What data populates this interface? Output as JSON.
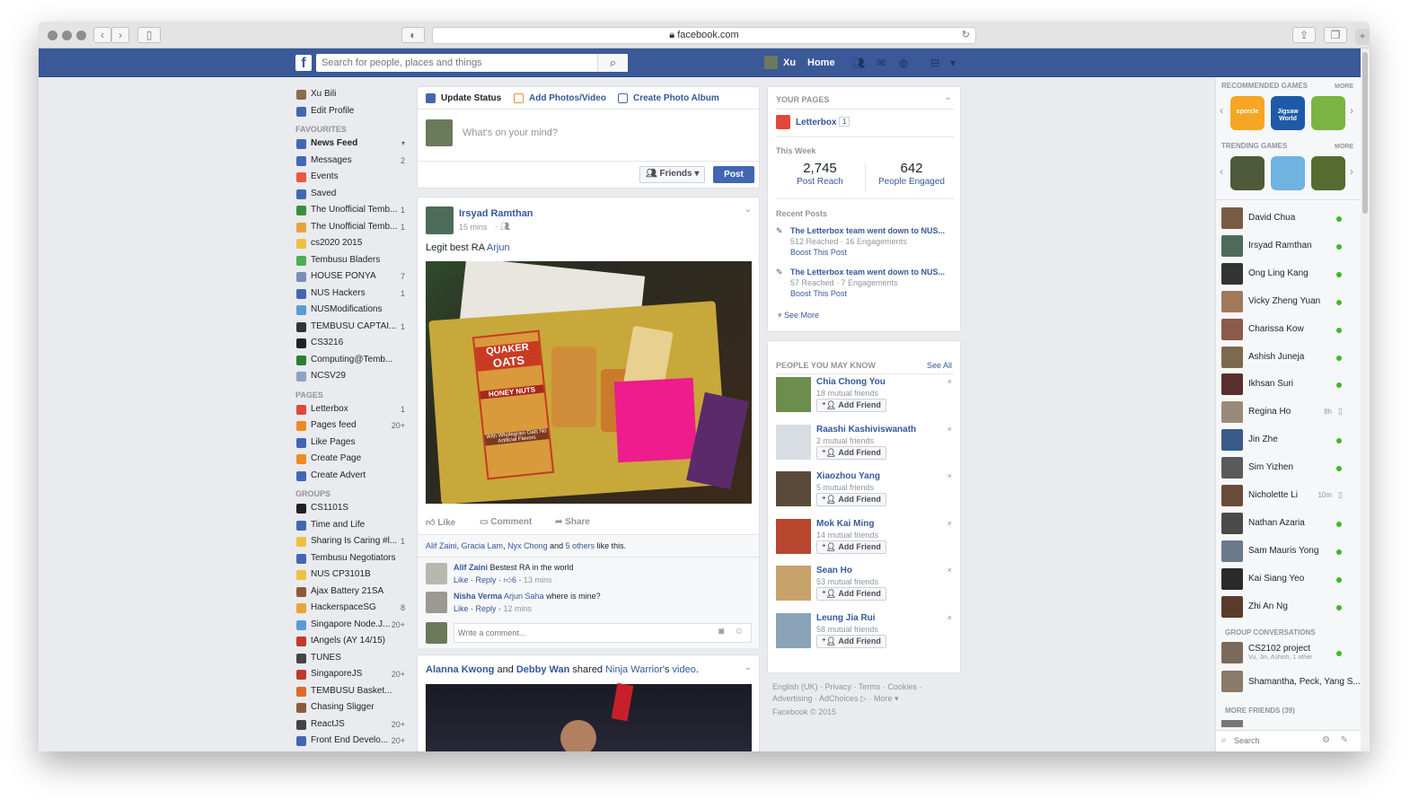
{
  "browser": {
    "url": "facebook.com"
  },
  "header": {
    "search_placeholder": "Search for people, places and things",
    "user_name": "Xu",
    "home": "Home"
  },
  "leftnav": {
    "profile": [
      {
        "label": "Xu Bili",
        "color": "#8a6d4a"
      },
      {
        "label": "Edit Profile",
        "color": "#4267b2"
      }
    ],
    "favourites_title": "FAVOURITES",
    "favourites": [
      {
        "label": "News Feed",
        "count": "",
        "color": "#4267b2",
        "bold": true
      },
      {
        "label": "Messages",
        "count": "2",
        "color": "#4267b2"
      },
      {
        "label": "Events",
        "count": "",
        "color": "#e9573f"
      },
      {
        "label": "Saved",
        "count": "",
        "color": "#4267b2"
      },
      {
        "label": "The Unofficial Temb...",
        "count": "1",
        "color": "#3a8f3a"
      },
      {
        "label": "The Unofficial Temb...",
        "count": "1",
        "color": "#e8a33a"
      },
      {
        "label": "cs2020 2015",
        "count": "",
        "color": "#f0c040"
      },
      {
        "label": "Tembusu Bladers",
        "count": "",
        "color": "#4caf50"
      },
      {
        "label": "HOUSE PONYA",
        "count": "7",
        "color": "#7a8fb5"
      },
      {
        "label": "NUS Hackers",
        "count": "1",
        "color": "#4267b2"
      },
      {
        "label": "NUSModifications",
        "count": "",
        "color": "#5b9bd5"
      },
      {
        "label": "TEMBUSU CAPTAI...",
        "count": "1",
        "color": "#333333"
      },
      {
        "label": "CS3216",
        "count": "",
        "color": "#222222"
      },
      {
        "label": "Computing@Temb...",
        "count": "",
        "color": "#2e7d32"
      },
      {
        "label": "NCSV29",
        "count": "",
        "color": "#8ea2c6"
      }
    ],
    "pages_title": "PAGES",
    "pages": [
      {
        "label": "Letterbox",
        "count": "1",
        "color": "#e0483e"
      },
      {
        "label": "Pages feed",
        "count": "20+",
        "color": "#f08a24"
      },
      {
        "label": "Like Pages",
        "count": "",
        "color": "#4267b2"
      },
      {
        "label": "Create Page",
        "count": "",
        "color": "#f08a24"
      },
      {
        "label": "Create Advert",
        "count": "",
        "color": "#4267b2"
      }
    ],
    "groups_title": "GROUPS",
    "groups": [
      {
        "label": "CS1101S",
        "count": "",
        "color": "#222222"
      },
      {
        "label": "Time and Life",
        "count": "",
        "color": "#4267b2"
      },
      {
        "label": "Sharing Is Caring #l...",
        "count": "1",
        "color": "#f0c040"
      },
      {
        "label": "Tembusu Negotiators",
        "count": "",
        "color": "#4267b2"
      },
      {
        "label": "NUS CP3101B",
        "count": "",
        "color": "#f0c040"
      },
      {
        "label": "Ajax Battery 21SA",
        "count": "",
        "color": "#8d5a3b"
      },
      {
        "label": "HackerspaceSG",
        "count": "8",
        "color": "#e8a33a"
      },
      {
        "label": "Singapore Node.J...",
        "count": "20+",
        "color": "#5b9bd5"
      },
      {
        "label": "tAngels (AY 14/15)",
        "count": "",
        "color": "#c0392b"
      },
      {
        "label": "TUNES",
        "count": "",
        "color": "#444444"
      },
      {
        "label": "SingaporeJS",
        "count": "20+",
        "color": "#c0392b"
      },
      {
        "label": "TEMBUSU Basket...",
        "count": "",
        "color": "#e06a2a"
      },
      {
        "label": "Chasing Sligger",
        "count": "",
        "color": "#8d5a3b"
      },
      {
        "label": "ReactJS",
        "count": "20+",
        "color": "#444444"
      },
      {
        "label": "Front End Develo...",
        "count": "20+",
        "color": "#4267b2"
      }
    ]
  },
  "composer": {
    "update_status": "Update Status",
    "add_photos": "Add Photos/Video",
    "create_album": "Create Photo Album",
    "placeholder": "What's on your mind?",
    "audience": "Friends",
    "post": "Post"
  },
  "post1": {
    "author": "Irsyad Ramthan",
    "time": "15 mins",
    "text": "Legit best RA ",
    "mention": "Arjun",
    "actions": {
      "like": "Like",
      "comment": "Comment",
      "share": "Share"
    },
    "likes": {
      "a": "Alif Zaini",
      "b": "Gracia Lam",
      "c": "Nyx Chong",
      "and": " and ",
      "others": "5 others",
      "suffix": " like this."
    },
    "comments": [
      {
        "author": "Alif Zaini",
        "text": "Bestest RA in the world",
        "like": "Like",
        "reply": "Reply",
        "likes": "6",
        "time": "13 mins"
      },
      {
        "author": "Nisha Verma",
        "mention": "Arjun Saha",
        "text": "where is mine?",
        "like": "Like",
        "reply": "Reply",
        "time": "12 mins"
      }
    ],
    "comment_placeholder": "Write a comment...",
    "photo_labels": {
      "brand": "QUAKER",
      "product": "OATS",
      "flavor": "HONEY NUTS",
      "note": "With Wholegrain Oats No Artificial Flavors"
    }
  },
  "post2": {
    "a": "Alanna Kwong",
    "and": " and ",
    "b": "Debby Wan",
    "shared": " shared ",
    "page": "Ninja Warrior",
    "suffix": "'s ",
    "video": "video",
    "end": "."
  },
  "your_pages": {
    "title": "YOUR PAGES",
    "page_name": "Letterbox",
    "page_badge": "1",
    "this_week": "This Week",
    "reach_value": "2,745",
    "reach_label": "Post Reach",
    "engaged_value": "642",
    "engaged_label": "People Engaged",
    "recent_title": "Recent Posts",
    "recent": [
      {
        "title": "The Letterbox team went down to NUS...",
        "stats": "512 Reached · 16 Engagements",
        "boost": "Boost This Post"
      },
      {
        "title": "The Letterbox team went down to NUS...",
        "stats": "57 Reached · 7 Engagements",
        "boost": "Boost This Post"
      }
    ],
    "see_more": "See More"
  },
  "pymk": {
    "title": "PEOPLE YOU MAY KNOW",
    "see_all": "See All",
    "add_label": "Add Friend",
    "people": [
      {
        "name": "Chia Chong You",
        "mutual": "18 mutual friends",
        "color": "#6b8e4e"
      },
      {
        "name": "Raashi Kashiviswanath",
        "mutual": "2 mutual friends",
        "color": "#d8dce3"
      },
      {
        "name": "Xiaozhou Yang",
        "mutual": "5 mutual friends",
        "color": "#5a4a3a"
      },
      {
        "name": "Mok Kai Ming",
        "mutual": "14 mutual friends",
        "color": "#b8462e"
      },
      {
        "name": "Sean Ho",
        "mutual": "53 mutual friends",
        "color": "#c7a36b"
      },
      {
        "name": "Leung Jia Rui",
        "mutual": "58 mutual friends",
        "color": "#8aa3b8"
      }
    ]
  },
  "footer": {
    "line1": "English (UK) · Privacy · Terms · Cookies ·",
    "line2": "Advertising · AdChoices ▷ · More ▾",
    "copyright": "Facebook © 2015"
  },
  "sidebar": {
    "recommended_title": "RECOMMENDED GAMES",
    "trending_title": "TRENDING GAMES",
    "more": "MORE",
    "rec_games": [
      {
        "label": "sporcle",
        "color": "#f5a623"
      },
      {
        "label": "Jigsaw World",
        "color": "#1e5aa8"
      },
      {
        "label": "",
        "color": "#7cb342"
      }
    ],
    "trend_games": [
      {
        "color": "#4e5a3a"
      },
      {
        "color": "#6fb3e0"
      },
      {
        "color": "#556b2f"
      }
    ],
    "friends": [
      {
        "name": "David Chua",
        "status": "online",
        "color": "#7a5c45"
      },
      {
        "name": "Irsyad Ramthan",
        "status": "online",
        "color": "#4e6b5a"
      },
      {
        "name": "Ong Ling Kang",
        "status": "online",
        "color": "#333333"
      },
      {
        "name": "Vicky Zheng Yuan",
        "status": "online",
        "color": "#a0785a"
      },
      {
        "name": "Charissa Kow",
        "status": "online",
        "color": "#8a5a4a"
      },
      {
        "name": "Ashish Juneja",
        "status": "online",
        "color": "#7d6a4e"
      },
      {
        "name": "Ikhsan Suri",
        "status": "online",
        "color": "#5a2e2e"
      },
      {
        "name": "Regina Ho",
        "status": "8h",
        "color": "#9a8a7a"
      },
      {
        "name": "Jin Zhe",
        "status": "online",
        "color": "#3a5a8a"
      },
      {
        "name": "Sim Yizhen",
        "status": "online",
        "color": "#5a5a5a"
      },
      {
        "name": "Nicholette Li",
        "status": "10m",
        "color": "#6a4a3a"
      },
      {
        "name": "Nathan Azaria",
        "status": "online",
        "color": "#4a4a4a"
      },
      {
        "name": "Sam Mauris Yong",
        "status": "online",
        "color": "#6a7a8a"
      },
      {
        "name": "Kai Siang Yeo",
        "status": "online",
        "color": "#2a2a2a"
      },
      {
        "name": "Zhi An Ng",
        "status": "online",
        "color": "#5a3a2a"
      }
    ],
    "group_conv_title": "GROUP CONVERSATIONS",
    "groups": [
      {
        "name": "CS2102 project",
        "sub": "Vu, Jin, Ashish, 1 other",
        "color": "#7a6a5a"
      },
      {
        "name": "Shamantha, Peck, Yang S...",
        "sub": "",
        "color": "#8a7a6a"
      }
    ],
    "more_friends": "MORE FRIENDS (39)",
    "search_placeholder": "Search"
  }
}
